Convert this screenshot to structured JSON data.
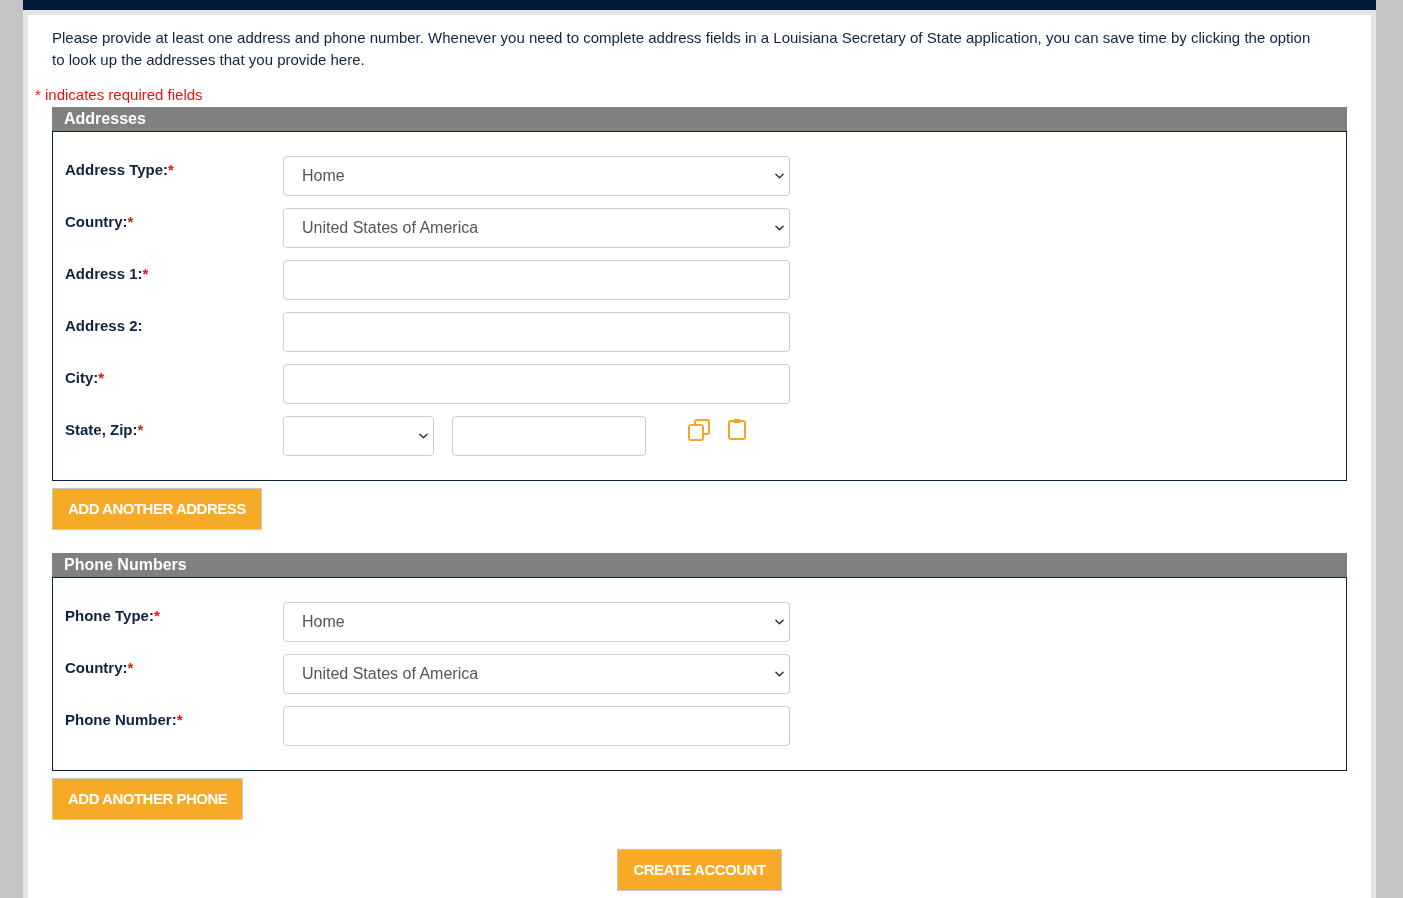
{
  "intro": "Please provide at least one address and phone number. Whenever you need to complete address fields in a Louisiana Secretary of State application, you can save time by clicking the option to look up the addresses that you provide here.",
  "required_note": "* indicates required fields",
  "sections": [
    {
      "title": "Addresses",
      "fields": [
        {
          "kind": "select",
          "label": "Address Type:",
          "required_mark": "*",
          "value": "Home"
        },
        {
          "kind": "select",
          "label": "Country:",
          "required_mark": "*",
          "value": "United States of America"
        },
        {
          "kind": "text",
          "label": "Address 1:",
          "required_mark": "*"
        },
        {
          "kind": "text",
          "label": "Address 2:"
        },
        {
          "kind": "text",
          "label": "City:",
          "required_mark": "*"
        },
        {
          "kind": "state_zip",
          "label": "State, Zip:",
          "required_mark": "*"
        }
      ],
      "add_button": "ADD ANOTHER ADDRESS"
    },
    {
      "title": "Phone Numbers",
      "fields": [
        {
          "kind": "select",
          "label": "Phone Type:",
          "required_mark": "*",
          "value": "Home"
        },
        {
          "kind": "select",
          "label": "Country:",
          "required_mark": "*",
          "value": "United States of America"
        },
        {
          "kind": "text",
          "label": "Phone Number:",
          "required_mark": "*"
        }
      ],
      "add_button": "ADD ANOTHER PHONE"
    }
  ],
  "submit_button": "CREATE ACCOUNT"
}
